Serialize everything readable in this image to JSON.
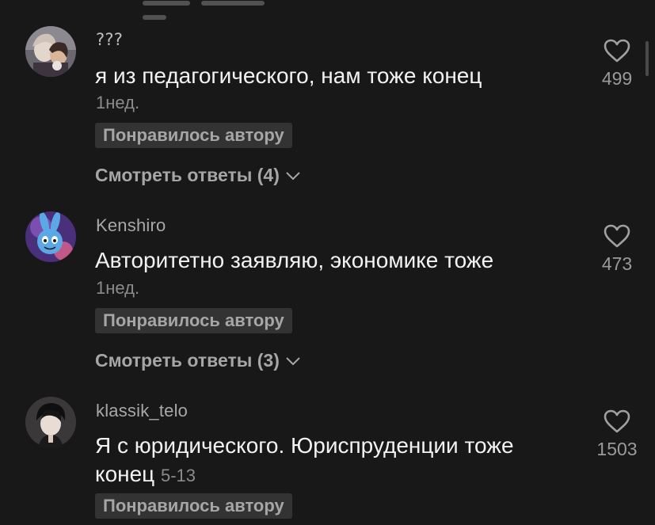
{
  "comments": [
    {
      "username": "???",
      "text": "я из педагогического, нам тоже конец",
      "time": "1нед.",
      "liked_by_author": "Понравилось автору",
      "view_replies": "Смотреть ответы (4)",
      "likes": "499",
      "avatar_icon": "anime-couple-avatar"
    },
    {
      "username": "Kenshiro",
      "text": "Авторитетно заявляю, экономике тоже",
      "time": "1нед.",
      "liked_by_author": "Понравилось автору",
      "view_replies": "Смотреть ответы (3)",
      "likes": "473",
      "avatar_icon": "blue-rabbit-avatar"
    },
    {
      "username": "klassik_telo",
      "text": "Я с юридического. Юриспруденции тоже конец",
      "time": "5-13",
      "liked_by_author": "Понравилось автору",
      "likes": "1503",
      "avatar_icon": "anime-man-avatar"
    }
  ],
  "icons": {
    "like": "heart-outline-icon",
    "expand": "chevron-down-icon"
  }
}
